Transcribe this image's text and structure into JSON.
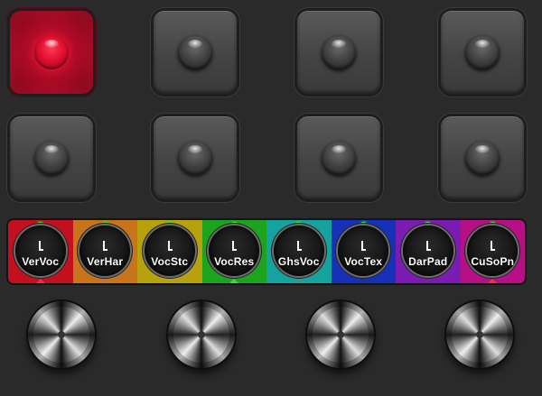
{
  "pads": [
    {
      "id": "pad-1",
      "active": true
    },
    {
      "id": "pad-2",
      "active": false
    },
    {
      "id": "pad-3",
      "active": false
    },
    {
      "id": "pad-4",
      "active": false
    },
    {
      "id": "pad-5",
      "active": false
    },
    {
      "id": "pad-6",
      "active": false
    },
    {
      "id": "pad-7",
      "active": false
    },
    {
      "id": "pad-8",
      "active": false
    }
  ],
  "strip": {
    "slots": [
      {
        "label": "VerVoc",
        "color": "#c40f1f"
      },
      {
        "label": "VerHar",
        "color": "#c7741b"
      },
      {
        "label": "VocStc",
        "color": "#b7a10c"
      },
      {
        "label": "VocRes",
        "color": "#1ca41f"
      },
      {
        "label": "GhsVoc",
        "color": "#16a3a0"
      },
      {
        "label": "VocTex",
        "color": "#1630b8"
      },
      {
        "label": "DarPad",
        "color": "#7a1bb1"
      },
      {
        "label": "CuSoPn",
        "color": "#b70f86"
      }
    ],
    "indicator_color": "#2ee02e",
    "marker_color": "#ff2a4a"
  },
  "big_knobs": [
    {
      "id": "knob-1"
    },
    {
      "id": "knob-2"
    },
    {
      "id": "knob-3"
    },
    {
      "id": "knob-4"
    }
  ]
}
